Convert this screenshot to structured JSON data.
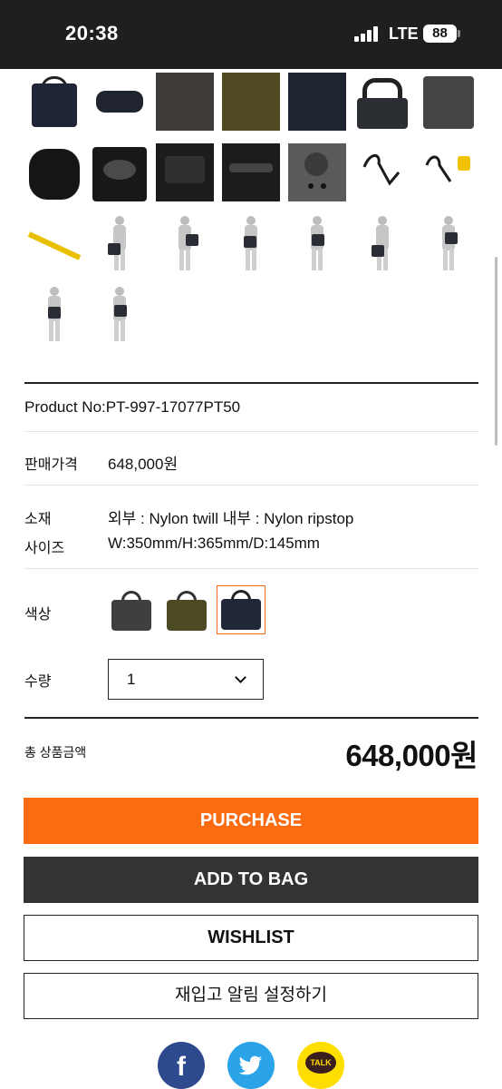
{
  "status_bar": {
    "time": "20:38",
    "network": "LTE",
    "battery": "88"
  },
  "product": {
    "number_label": "Product No:PT-997-17077PT50",
    "price_label": "판매가격",
    "price_value": "648,000원",
    "material_label": "소재",
    "material_value": "외부 : Nylon twill 내부 : Nylon ripstop",
    "size_label": "사이즈",
    "size_value": "W:350mm/H:365mm/D:145mm",
    "color_label": "색상",
    "colors": [
      {
        "name": "gray",
        "hex": "#3f3f3f",
        "selected": false
      },
      {
        "name": "olive",
        "hex": "#4b4a22",
        "selected": false
      },
      {
        "name": "navy",
        "hex": "#1f2738",
        "selected": true
      }
    ],
    "quantity_label": "수량",
    "quantity_value": "1"
  },
  "total": {
    "label": "총 상품금액",
    "value": "648,000원"
  },
  "buttons": {
    "purchase": "PURCHASE",
    "add_to_bag": "ADD TO BAG",
    "wishlist": "WISHLIST",
    "restock": "재입고 알림 설정하기"
  },
  "share": {
    "facebook_glyph": "f",
    "kakao_text": "TALK"
  },
  "colors": {
    "accent": "#fb6b12",
    "dark_button": "#333333",
    "facebook": "#2d4a8f",
    "twitter": "#2aa3e8",
    "kakao": "#fedd00"
  }
}
